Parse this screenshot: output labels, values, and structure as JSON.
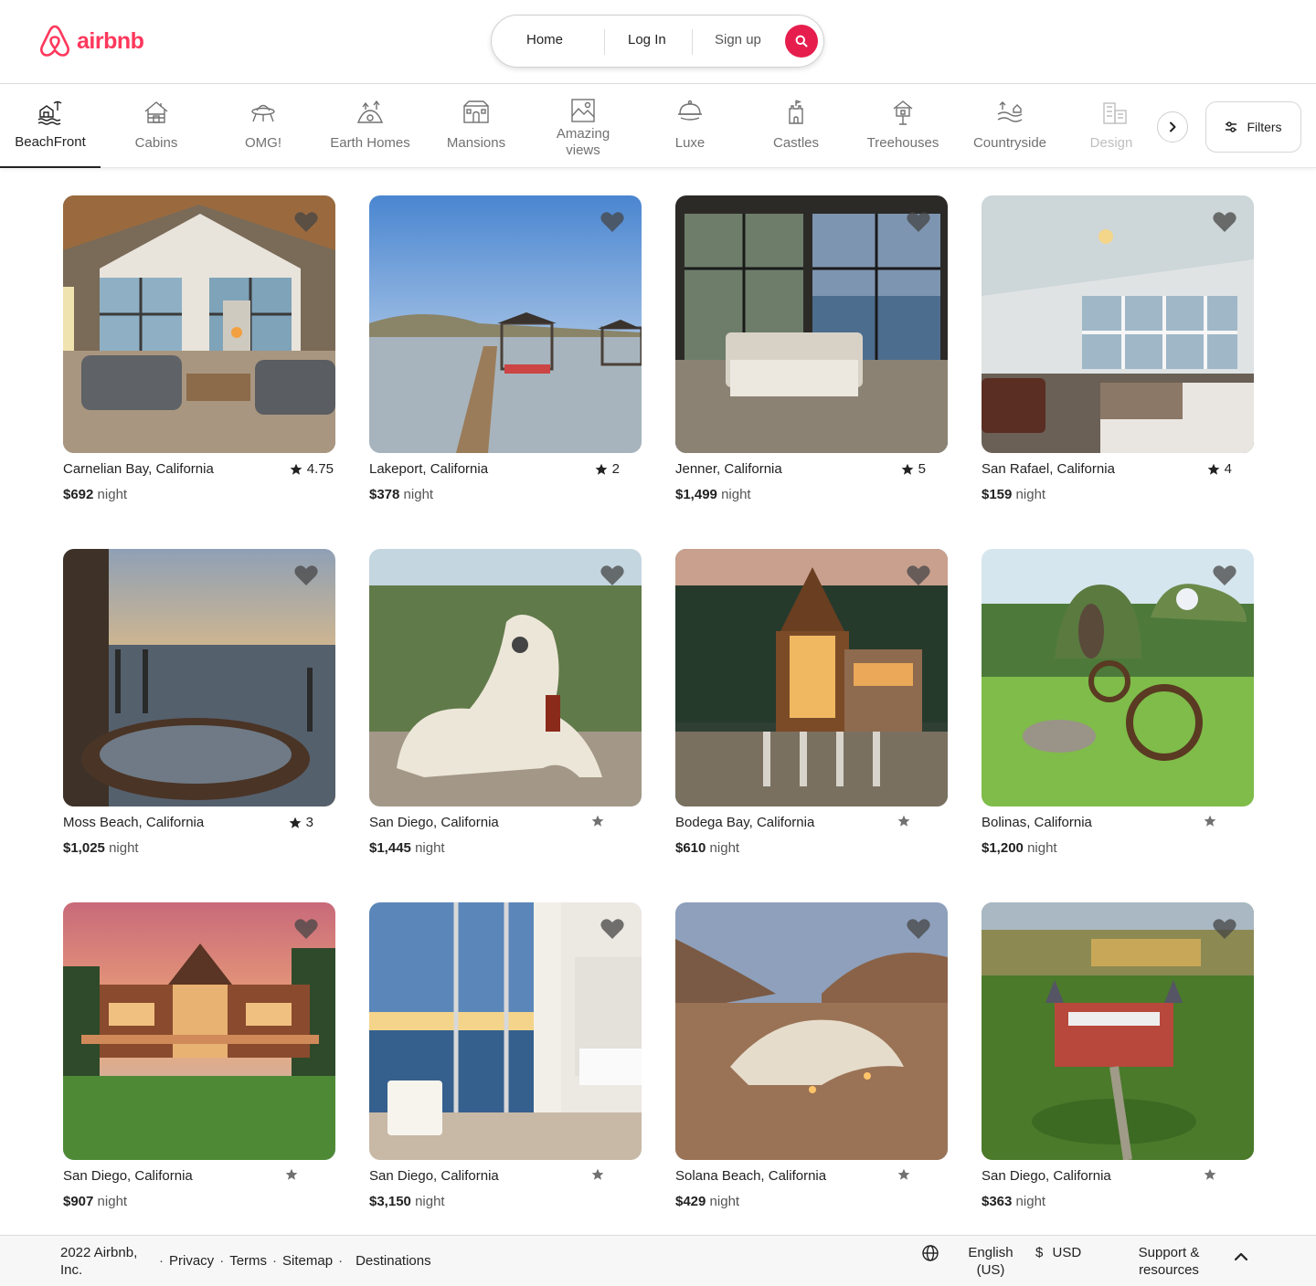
{
  "brand": {
    "name": "airbnb",
    "accent": "#ff385c"
  },
  "search": {
    "home": "Home",
    "login": "Log In",
    "signup": "Sign up",
    "icon": "search-icon"
  },
  "categories": [
    {
      "label": "BeachFront",
      "icon": "beachfront-icon",
      "active": true
    },
    {
      "label": "Cabins",
      "icon": "cabin-icon"
    },
    {
      "label": "OMG!",
      "icon": "ufo-icon"
    },
    {
      "label": "Earth Homes",
      "icon": "earth-home-icon"
    },
    {
      "label": "Mansions",
      "icon": "mansion-icon"
    },
    {
      "label": "Amazing views",
      "icon": "amazing-views-icon"
    },
    {
      "label": "Luxe",
      "icon": "luxe-icon"
    },
    {
      "label": "Castles",
      "icon": "castle-icon"
    },
    {
      "label": "Treehouses",
      "icon": "treehouse-icon"
    },
    {
      "label": "Countryside",
      "icon": "countryside-icon"
    },
    {
      "label": "Design",
      "icon": "design-icon"
    }
  ],
  "filters": {
    "label": "Filters",
    "icon": "filters-icon"
  },
  "listings": [
    {
      "location": "Carnelian Bay, California",
      "rating": "4.75",
      "price": "$692",
      "unit": "night"
    },
    {
      "location": "Lakeport, California",
      "rating": "2",
      "price": "$378",
      "unit": "night"
    },
    {
      "location": "Jenner, California",
      "rating": "5",
      "price": "$1,499",
      "unit": "night"
    },
    {
      "location": "San Rafael, California",
      "rating": "4",
      "price": "$159",
      "unit": "night"
    },
    {
      "location": "Moss Beach, California",
      "rating": "3",
      "price": "$1,025",
      "unit": "night"
    },
    {
      "location": "San Diego, California",
      "rating": "",
      "price": "$1,445",
      "unit": "night"
    },
    {
      "location": "Bodega Bay, California",
      "rating": "",
      "price": "$610",
      "unit": "night"
    },
    {
      "location": "Bolinas, California",
      "rating": "",
      "price": "$1,200",
      "unit": "night"
    },
    {
      "location": "San Diego, California",
      "rating": "",
      "price": "$907",
      "unit": "night"
    },
    {
      "location": "San Diego, California",
      "rating": "",
      "price": "$3,150",
      "unit": "night"
    },
    {
      "location": "Solana Beach, California",
      "rating": "",
      "price": "$429",
      "unit": "night"
    },
    {
      "location": "San Diego, California",
      "rating": "",
      "price": "$363",
      "unit": "night"
    }
  ],
  "footer": {
    "copyright": "2022 Airbnb, Inc.",
    "links": [
      "Privacy",
      "Terms",
      "Sitemap",
      "Destinations"
    ],
    "language": "English (US)",
    "currency_symbol": "$",
    "currency": "USD",
    "support": "Support & resources"
  }
}
